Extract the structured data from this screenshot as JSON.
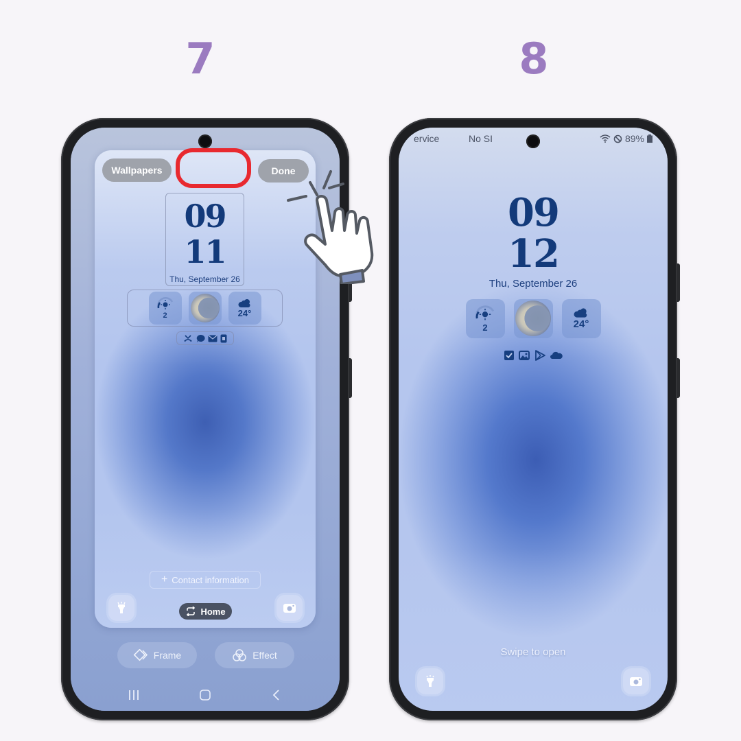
{
  "steps": [
    {
      "number": "7",
      "editor": {
        "wallpapers_label": "Wallpapers",
        "done_label": "Done",
        "clock_hour": "09",
        "clock_minute": "11",
        "date": "Thu, September 26",
        "widgets": [
          {
            "icon": "sun-gauge-icon",
            "value": "2"
          },
          {
            "icon": "moon-phase-icon",
            "value": ""
          },
          {
            "icon": "cloud-icon",
            "value": "24°"
          }
        ],
        "notification_icons": [
          "missed-call-icon",
          "message-icon",
          "mail-icon",
          "sim-icon"
        ],
        "contact_label": "Contact information",
        "home_label": "Home",
        "frame_label": "Frame",
        "effect_label": "Effect"
      }
    },
    {
      "number": "8",
      "lockscreen": {
        "status_left_1": "ervice",
        "status_left_2": "No SI",
        "battery": "89%",
        "clock_hour": "09",
        "clock_minute": "12",
        "date": "Thu, September 26",
        "widgets": [
          {
            "icon": "sun-gauge-icon",
            "value": "2"
          },
          {
            "icon": "moon-phase-icon",
            "value": ""
          },
          {
            "icon": "cloud-icon",
            "value": "24°"
          }
        ],
        "notification_icons": [
          "checkbox-icon",
          "gallery-icon",
          "play-store-icon",
          "cloud-icon"
        ],
        "swipe_label": "Swipe to open"
      }
    }
  ],
  "colors": {
    "step_number": "#9b7bc0",
    "highlight_ring": "#e8292f",
    "clock_text": "#133a7a"
  }
}
